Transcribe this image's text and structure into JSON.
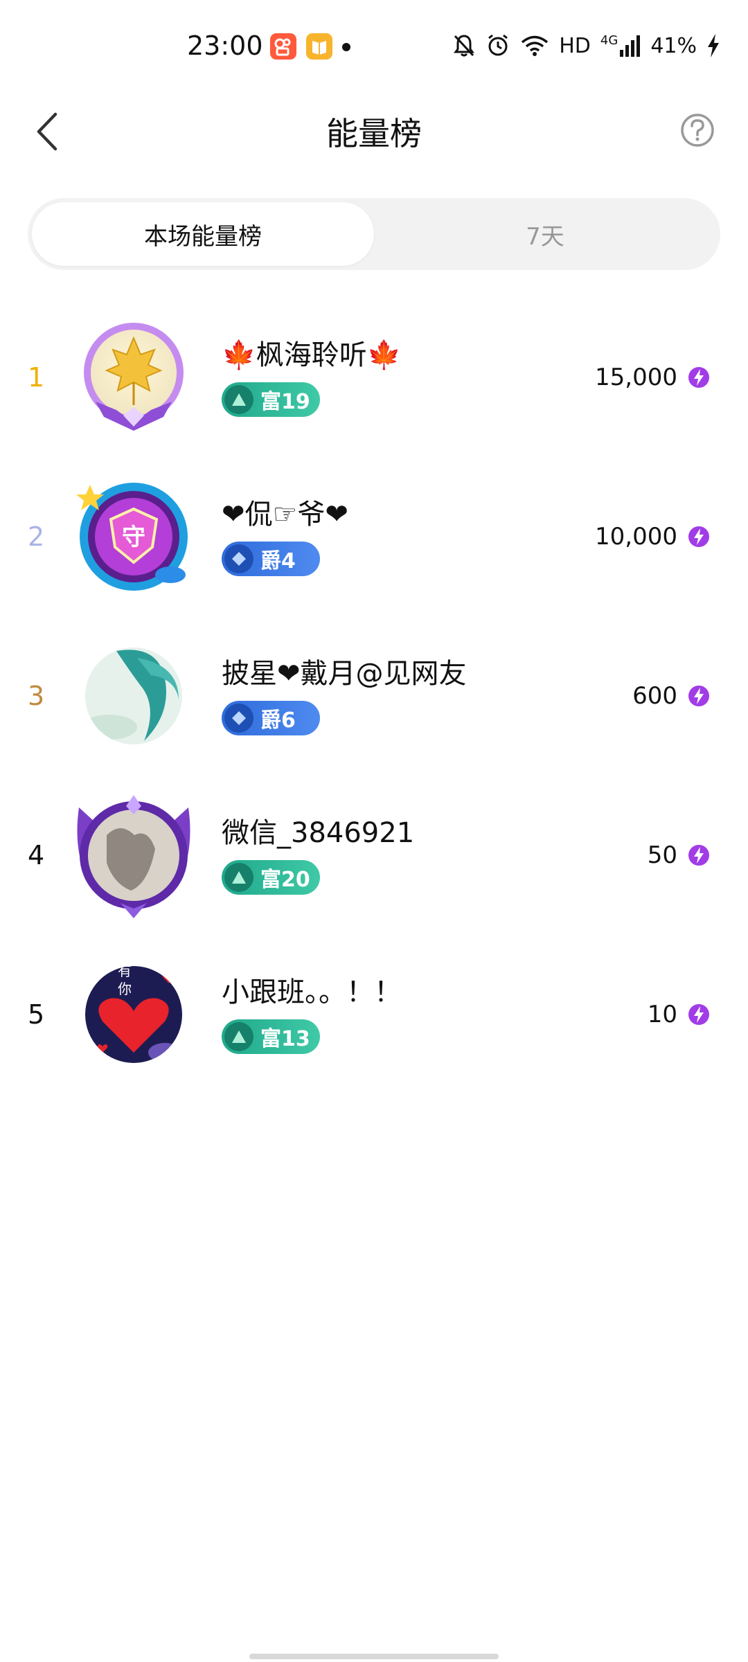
{
  "status_bar": {
    "time": "23:00",
    "network_hd": "HD",
    "network_4g": "4G",
    "battery": "41%"
  },
  "header": {
    "title": "能量榜"
  },
  "tabs": [
    {
      "label": "本场能量榜",
      "active": true
    },
    {
      "label": "7天",
      "active": false
    }
  ],
  "ranking": [
    {
      "rank": "1",
      "rank_color": "#f0b000",
      "name": "🍁枫海聆听🍁",
      "badge_type": "fu",
      "badge": "富19",
      "score": "15,000"
    },
    {
      "rank": "2",
      "rank_color": "#a9b4e6",
      "name": "❤侃☞爷❤",
      "badge_type": "jue",
      "badge": "爵4",
      "score": "10,000"
    },
    {
      "rank": "3",
      "rank_color": "#c08a40",
      "name": "披星❤戴月@见网友",
      "badge_type": "jue",
      "badge": "爵6",
      "score": "600"
    },
    {
      "rank": "4",
      "rank_color": "#111111",
      "name": "微信_3846921",
      "badge_type": "fu",
      "badge": "富20",
      "score": "50"
    },
    {
      "rank": "5",
      "rank_color": "#111111",
      "name": "小跟班。。！！",
      "badge_type": "fu",
      "badge": "富13",
      "score": "10"
    }
  ],
  "icons": {
    "energy": "lightning-bolt-purple",
    "back": "chevron-left",
    "help": "question-circle"
  },
  "avatar_text": {
    "row2_badge": "守",
    "row5_line1": "有",
    "row5_line2": "你"
  }
}
